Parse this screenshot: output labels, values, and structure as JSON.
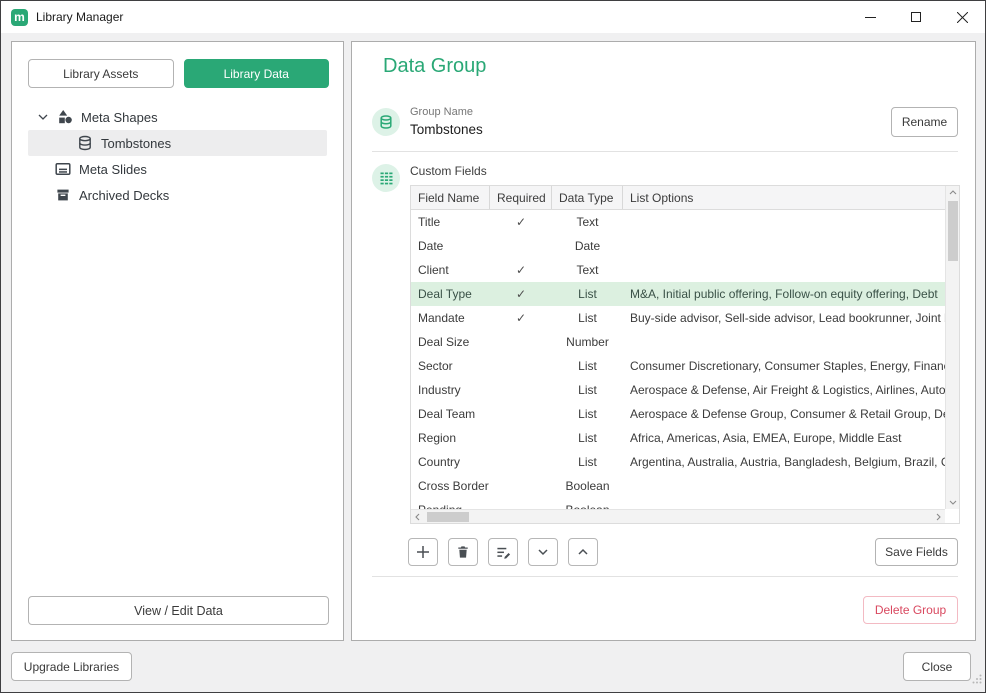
{
  "colors": {
    "accent": "#2aa876",
    "accent_light": "#ddf2e7",
    "selected_row": "#dcf0e0",
    "danger": "#d9485f"
  },
  "titlebar": {
    "title": "Library Manager",
    "logo_letter": "m",
    "icons": [
      "minimize-icon",
      "maximize-icon",
      "close-icon"
    ]
  },
  "sidebar": {
    "tabs": [
      {
        "label": "Library Assets",
        "active": false
      },
      {
        "label": "Library Data",
        "active": true
      }
    ],
    "tree": [
      {
        "label": "Meta Shapes",
        "icon": "shapes-icon",
        "expanded": true
      },
      {
        "label": "Tombstones",
        "icon": "database-icon",
        "selected": true
      },
      {
        "label": "Meta Slides",
        "icon": "slide-icon"
      },
      {
        "label": "Archived Decks",
        "icon": "archive-icon"
      }
    ],
    "view_edit_button": "View / Edit Data"
  },
  "main": {
    "heading": "Data Group",
    "group": {
      "label": "Group Name",
      "value": "Tombstones",
      "rename_button": "Rename"
    },
    "custom_fields": {
      "label": "Custom Fields",
      "columns": [
        "Field Name",
        "Required",
        "Data Type",
        "List Options"
      ],
      "required_glyph": "✓",
      "rows": [
        {
          "name": "Title",
          "required": true,
          "type": "Text",
          "options": ""
        },
        {
          "name": "Date",
          "required": false,
          "type": "Date",
          "options": ""
        },
        {
          "name": "Client",
          "required": true,
          "type": "Text",
          "options": ""
        },
        {
          "name": "Deal Type",
          "required": true,
          "type": "List",
          "options": "M&A, Initial public offering, Follow-on equity offering, Debt",
          "selected": true
        },
        {
          "name": "Mandate",
          "required": true,
          "type": "List",
          "options": "Buy-side advisor, Sell-side advisor, Lead bookrunner, Joint b"
        },
        {
          "name": "Deal Size",
          "required": false,
          "type": "Number",
          "options": ""
        },
        {
          "name": "Sector",
          "required": false,
          "type": "List",
          "options": "Consumer Discretionary, Consumer Staples, Energy, Financia"
        },
        {
          "name": "Industry",
          "required": false,
          "type": "List",
          "options": "Aerospace & Defense, Air Freight & Logistics, Airlines, Auto"
        },
        {
          "name": "Deal Team",
          "required": false,
          "type": "List",
          "options": "Aerospace & Defense Group, Consumer & Retail Group, Del"
        },
        {
          "name": "Region",
          "required": false,
          "type": "List",
          "options": "Africa, Americas, Asia, EMEA, Europe, Middle East"
        },
        {
          "name": "Country",
          "required": false,
          "type": "List",
          "options": "Argentina, Australia, Austria, Bangladesh, Belgium, Brazil, Ca"
        },
        {
          "name": "Cross Border",
          "required": false,
          "type": "Boolean",
          "options": ""
        },
        {
          "name": "Pending",
          "required": false,
          "type": "Boolean",
          "options": ""
        }
      ],
      "toolbar_icons": [
        "add-icon",
        "delete-icon",
        "edit-options-icon",
        "move-down-icon",
        "move-up-icon"
      ],
      "save_button": "Save Fields"
    },
    "delete_group_button": "Delete Group"
  },
  "footer": {
    "upgrade_button": "Upgrade Libraries",
    "close_button": "Close"
  }
}
